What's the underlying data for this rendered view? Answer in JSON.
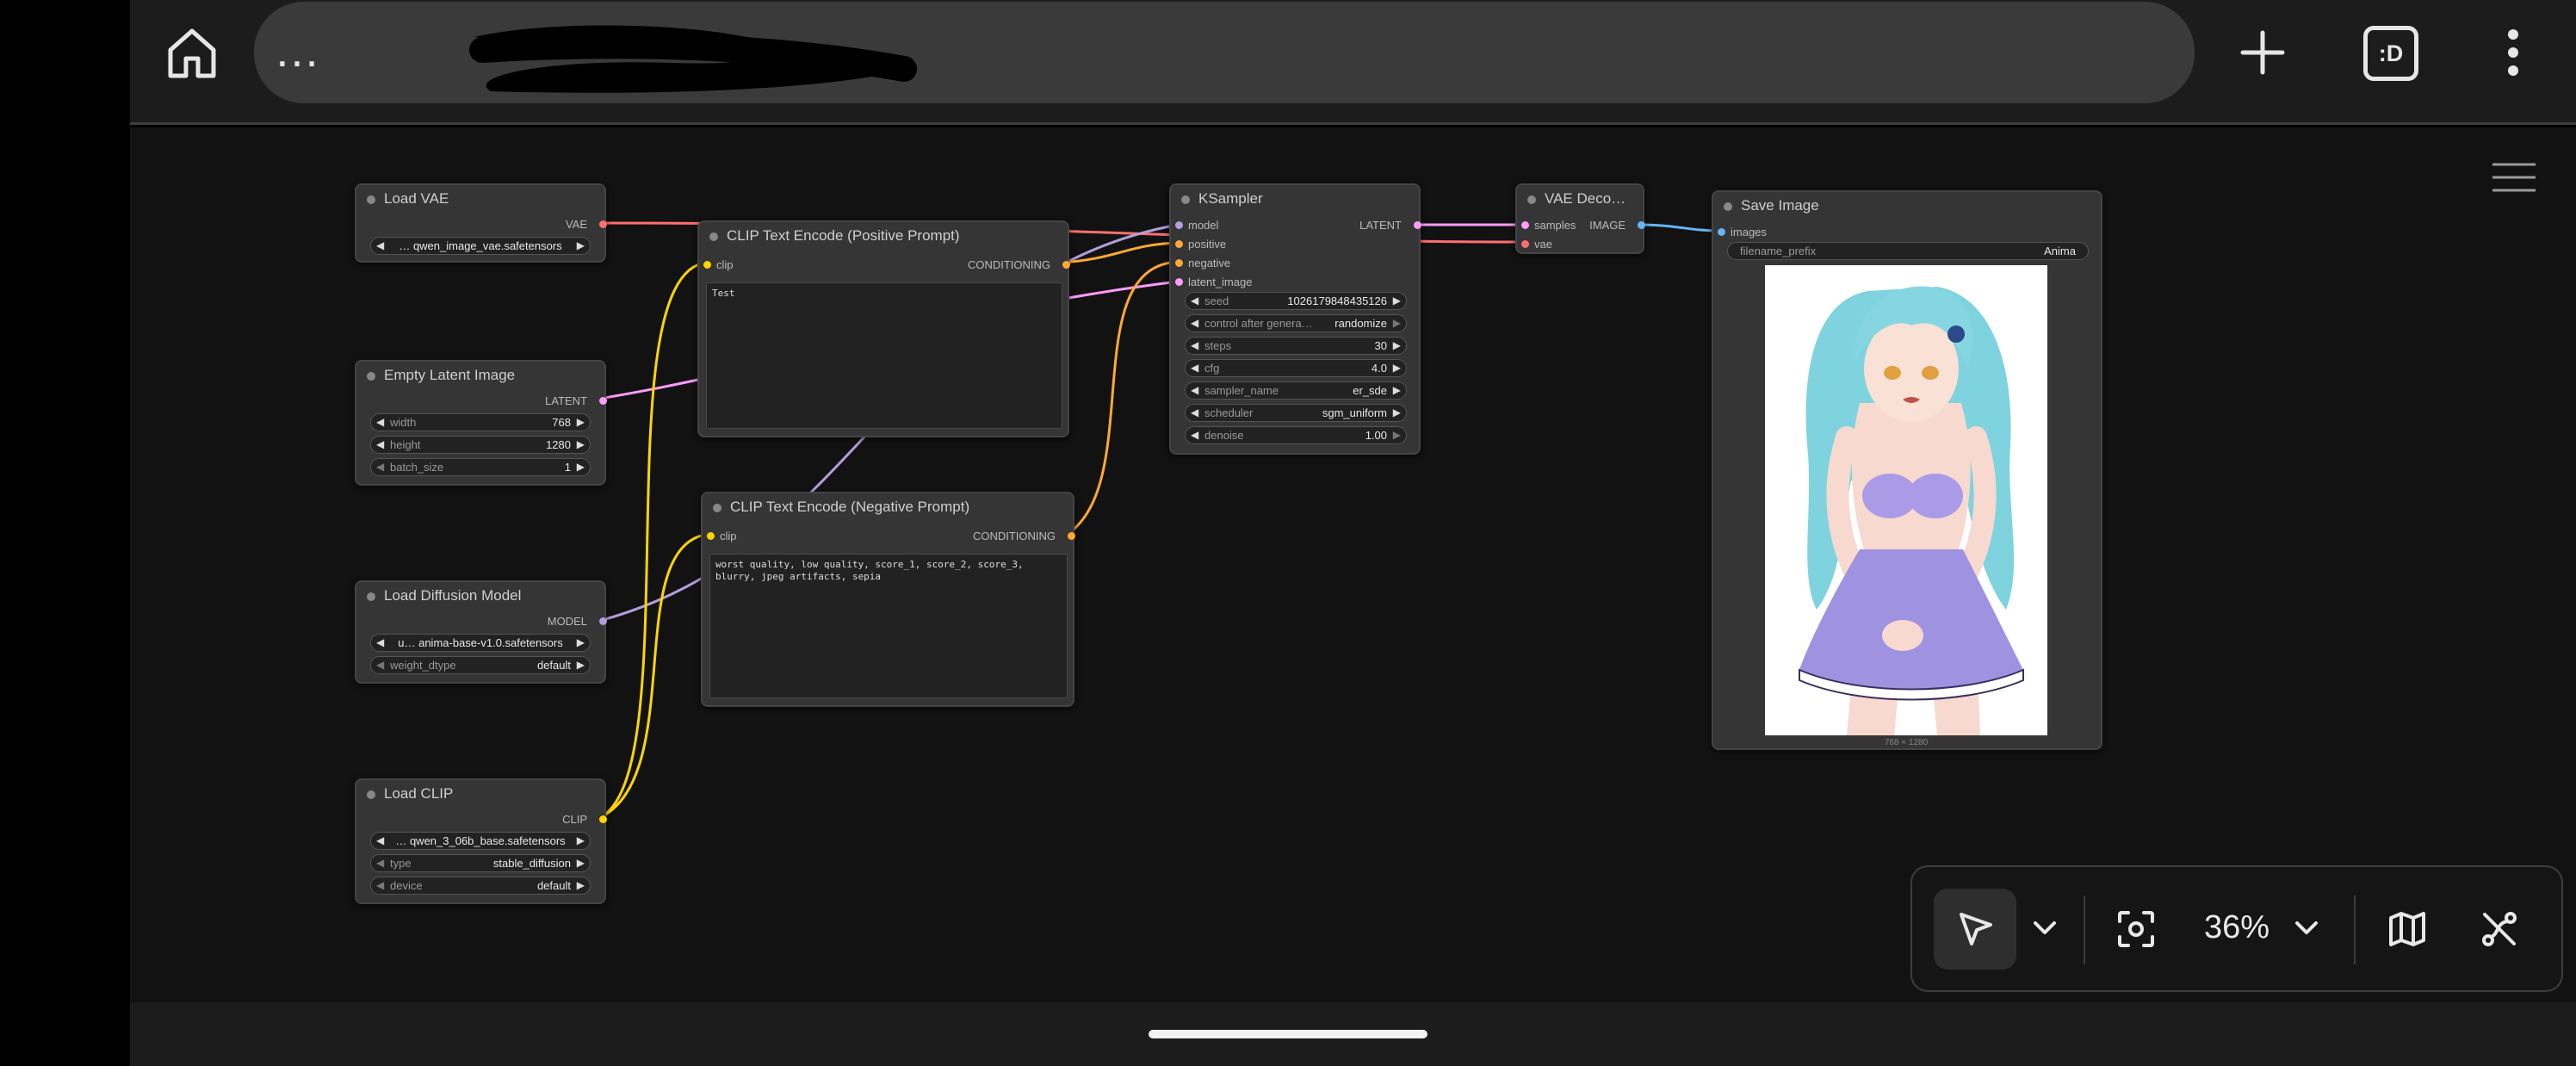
{
  "browser": {
    "url_text": "…",
    "tabs_button_label": ":D"
  },
  "nodes": {
    "load_vae": {
      "title": "Load VAE",
      "output": "VAE",
      "vae_name": "… qwen_image_vae.safetensors"
    },
    "empty_latent": {
      "title": "Empty Latent Image",
      "output": "LATENT",
      "widgets": [
        {
          "name": "width",
          "value": "768"
        },
        {
          "name": "height",
          "value": "1280"
        },
        {
          "name": "batch_size",
          "value": "1"
        }
      ]
    },
    "load_diffusion": {
      "title": "Load Diffusion Model",
      "output": "MODEL",
      "unet_name": "u… anima-base-v1.0.safetensors",
      "widgets": [
        {
          "name": "weight_dtype",
          "value": "default"
        }
      ]
    },
    "load_clip": {
      "title": "Load CLIP",
      "output": "CLIP",
      "clip_name": "… qwen_3_06b_base.safetensors",
      "widgets": [
        {
          "name": "type",
          "value": "stable_diffusion"
        },
        {
          "name": "device",
          "value": "default"
        }
      ]
    },
    "clip_pos": {
      "title": "CLIP Text Encode (Positive Prompt)",
      "input": "clip",
      "output": "CONDITIONING",
      "text": "Test"
    },
    "clip_neg": {
      "title": "CLIP Text Encode (Negative Prompt)",
      "input": "clip",
      "output": "CONDITIONING",
      "text": "worst quality, low quality, score_1, score_2, score_3, blurry, jpeg artifacts, sepia"
    },
    "ksampler": {
      "title": "KSampler",
      "inputs": [
        "model",
        "positive",
        "negative",
        "latent_image"
      ],
      "output": "LATENT",
      "widgets": [
        {
          "name": "seed",
          "value": "1026179848435126"
        },
        {
          "name": "control after genera…",
          "value": "randomize"
        },
        {
          "name": "steps",
          "value": "30"
        },
        {
          "name": "cfg",
          "value": "4.0"
        },
        {
          "name": "sampler_name",
          "value": "er_sde"
        },
        {
          "name": "scheduler",
          "value": "sgm_uniform"
        },
        {
          "name": "denoise",
          "value": "1.00"
        }
      ]
    },
    "vae_decode": {
      "title": "VAE Deco…",
      "inputs": [
        "samples",
        "vae"
      ],
      "output": "IMAGE"
    },
    "save_image": {
      "title": "Save Image",
      "input": "images",
      "filename_prefix_label": "filename_prefix",
      "filename_prefix_value": "Anima",
      "preview_caption": "768 × 1280"
    }
  },
  "toolbar": {
    "zoom": "36%"
  },
  "colors": {
    "vae": "#ff6e6e",
    "latent": "#ff9cf9",
    "model": "#b39ddb",
    "clip": "#ffd500",
    "conditioning": "#ffa931",
    "image": "#64b5f6"
  }
}
